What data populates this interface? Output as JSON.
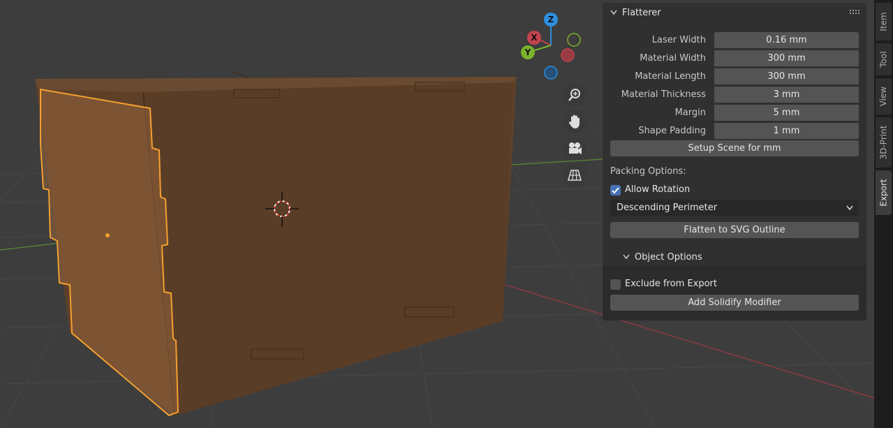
{
  "gizmo": {
    "z_label": "Z",
    "x_label": "X",
    "y_label": "Y",
    "colors": {
      "z": "#2c8fdf",
      "x": "#c4434f",
      "y": "#7ab32c"
    }
  },
  "nav_buttons": [
    {
      "icon": "zoom-icon"
    },
    {
      "icon": "hand-icon"
    },
    {
      "icon": "camera-icon"
    },
    {
      "icon": "grid-icon"
    }
  ],
  "panel": {
    "title": "Flatterer",
    "properties": [
      {
        "label": "Laser Width",
        "value": "0.16 mm"
      },
      {
        "label": "Material Width",
        "value": "300 mm"
      },
      {
        "label": "Material Length",
        "value": "300 mm"
      },
      {
        "label": "Material Thickness",
        "value": "3 mm"
      },
      {
        "label": "Margin",
        "value": "5 mm"
      },
      {
        "label": "Shape Padding",
        "value": "1 mm"
      }
    ],
    "setup_button": "Setup Scene for mm",
    "packing_label": "Packing Options:",
    "allow_rotation": {
      "label": "Allow Rotation",
      "checked": true
    },
    "sort_dropdown": "Descending Perimeter",
    "flatten_button": "Flatten to SVG Outline",
    "object_options": {
      "title": "Object Options",
      "exclude": {
        "label": "Exclude from Export",
        "checked": false
      },
      "solidify_button": "Add Solidify Modifier"
    }
  },
  "tabs": [
    {
      "label": "Item",
      "active": false
    },
    {
      "label": "Tool",
      "active": false
    },
    {
      "label": "View",
      "active": false
    },
    {
      "label": "3D-Print",
      "active": false
    },
    {
      "label": "Export",
      "active": true
    }
  ],
  "colors": {
    "accent": "#4772b3",
    "selection": "#f5a030",
    "box": "#5c3f27"
  }
}
